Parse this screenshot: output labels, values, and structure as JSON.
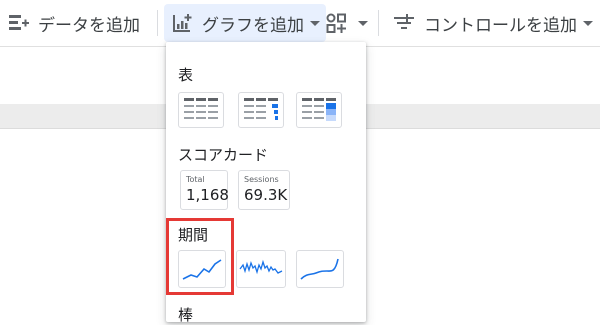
{
  "toolbar": {
    "add_data_label": "データを追加",
    "add_chart_label": "グラフを追加",
    "add_control_label": "コントロールを追加"
  },
  "menu": {
    "sections": {
      "table": "表",
      "scorecard": "スコアカード",
      "timeseries": "期間",
      "bar": "棒"
    },
    "scorecards": [
      {
        "label": "Total",
        "value": "1,168"
      },
      {
        "label": "Sessions",
        "value": "69.3K"
      }
    ]
  },
  "colors": {
    "accent": "#1a73e8",
    "active_bg": "#e8f0fe",
    "highlight": "#e53935"
  }
}
